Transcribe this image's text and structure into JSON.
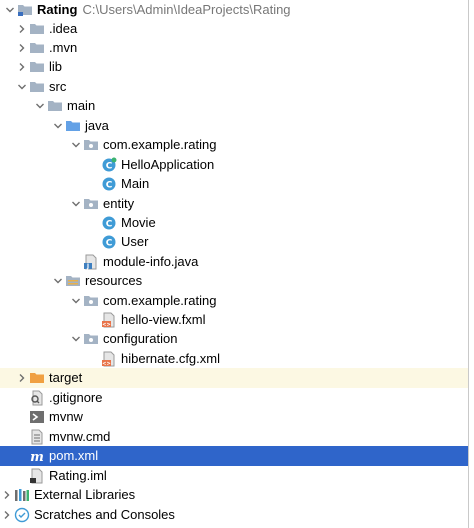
{
  "colors": {
    "selection": "#2f65ca",
    "excluded_bg": "#fcf8e3",
    "folder": "#a4b3c4",
    "source_folder": "#63a1e6",
    "resources_folder": "#e8b14b",
    "excluded_folder": "#f0a042",
    "class_icon": "#3f9bd6"
  },
  "tree": {
    "root": {
      "name": "Rating",
      "path": "C:\\Users\\Admin\\IdeaProjects\\Rating",
      "icon": "module-folder-icon"
    },
    "idea": {
      "name": ".idea",
      "icon": "folder-icon"
    },
    "mvn": {
      "name": ".mvn",
      "icon": "folder-icon"
    },
    "lib": {
      "name": "lib",
      "icon": "folder-icon"
    },
    "src": {
      "name": "src",
      "icon": "folder-icon"
    },
    "main": {
      "name": "main",
      "icon": "folder-icon"
    },
    "java": {
      "name": "java",
      "icon": "source-folder-icon"
    },
    "pkg_rating": {
      "name": "com.example.rating",
      "icon": "package-icon"
    },
    "hello_app": {
      "name": "HelloApplication",
      "icon": "java-class-icon"
    },
    "main_class": {
      "name": "Main",
      "icon": "java-class-icon"
    },
    "entity": {
      "name": "entity",
      "icon": "package-icon"
    },
    "movie": {
      "name": "Movie",
      "icon": "java-class-icon"
    },
    "user": {
      "name": "User",
      "icon": "java-class-icon"
    },
    "module_info": {
      "name": "module-info.java",
      "icon": "java-file-icon"
    },
    "resources": {
      "name": "resources",
      "icon": "resources-folder-icon"
    },
    "res_pkg": {
      "name": "com.example.rating",
      "icon": "package-icon"
    },
    "hello_view": {
      "name": "hello-view.fxml",
      "icon": "xml-file-icon"
    },
    "configuration": {
      "name": "configuration",
      "icon": "package-icon"
    },
    "hibernate": {
      "name": "hibernate.cfg.xml",
      "icon": "xml-file-icon"
    },
    "target": {
      "name": "target",
      "icon": "excluded-folder-icon"
    },
    "gitignore": {
      "name": ".gitignore",
      "icon": "gitignore-file-icon"
    },
    "mvnw": {
      "name": "mvnw",
      "icon": "shell-script-icon"
    },
    "mvnw_cmd": {
      "name": "mvnw.cmd",
      "icon": "text-file-icon"
    },
    "pom": {
      "name": "pom.xml",
      "icon": "maven-icon"
    },
    "iml": {
      "name": "Rating.iml",
      "icon": "module-file-icon"
    },
    "ext_libs": {
      "name": "External Libraries",
      "icon": "libraries-icon"
    },
    "scratches": {
      "name": "Scratches and Consoles",
      "icon": "scratches-icon"
    }
  }
}
